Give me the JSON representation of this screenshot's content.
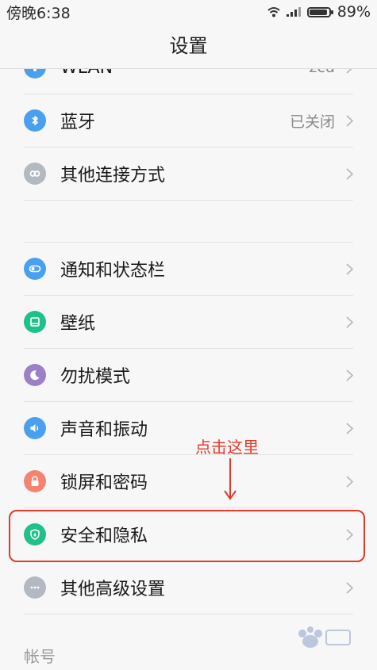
{
  "status_bar": {
    "time": "傍晚6:38",
    "battery": "89%",
    "battery_level": 0.89
  },
  "header": {
    "title": "设置"
  },
  "items": [
    {
      "label": "WLAN",
      "value": "zcd",
      "color": "#4aa0ee",
      "icon": "wifi-icon"
    },
    {
      "label": "蓝牙",
      "value": "已关闭",
      "color": "#4aa0ee",
      "icon": "bluetooth-icon"
    },
    {
      "label": "其他连接方式",
      "value": "",
      "color": "#b2b9c1",
      "icon": "link-icon"
    },
    {
      "label": "通知和状态栏",
      "value": "",
      "color": "#4aa0ee",
      "icon": "toggle-icon"
    },
    {
      "label": "壁纸",
      "value": "",
      "color": "#20c08a",
      "icon": "wallpaper-icon"
    },
    {
      "label": "勿扰模式",
      "value": "",
      "color": "#9b80c8",
      "icon": "moon-icon"
    },
    {
      "label": "声音和振动",
      "value": "",
      "color": "#4aa0ee",
      "icon": "speaker-icon"
    },
    {
      "label": "锁屏和密码",
      "value": "",
      "color": "#f28470",
      "icon": "lock-icon"
    },
    {
      "label": "安全和隐私",
      "value": "",
      "color": "#20c08a",
      "icon": "shield-icon"
    },
    {
      "label": "其他高级设置",
      "value": "",
      "color": "#b2b9c1",
      "icon": "more-icon"
    }
  ],
  "annotation": {
    "text": "点击这里",
    "color": "#e0392e"
  },
  "section": {
    "account_header": "帐号"
  }
}
